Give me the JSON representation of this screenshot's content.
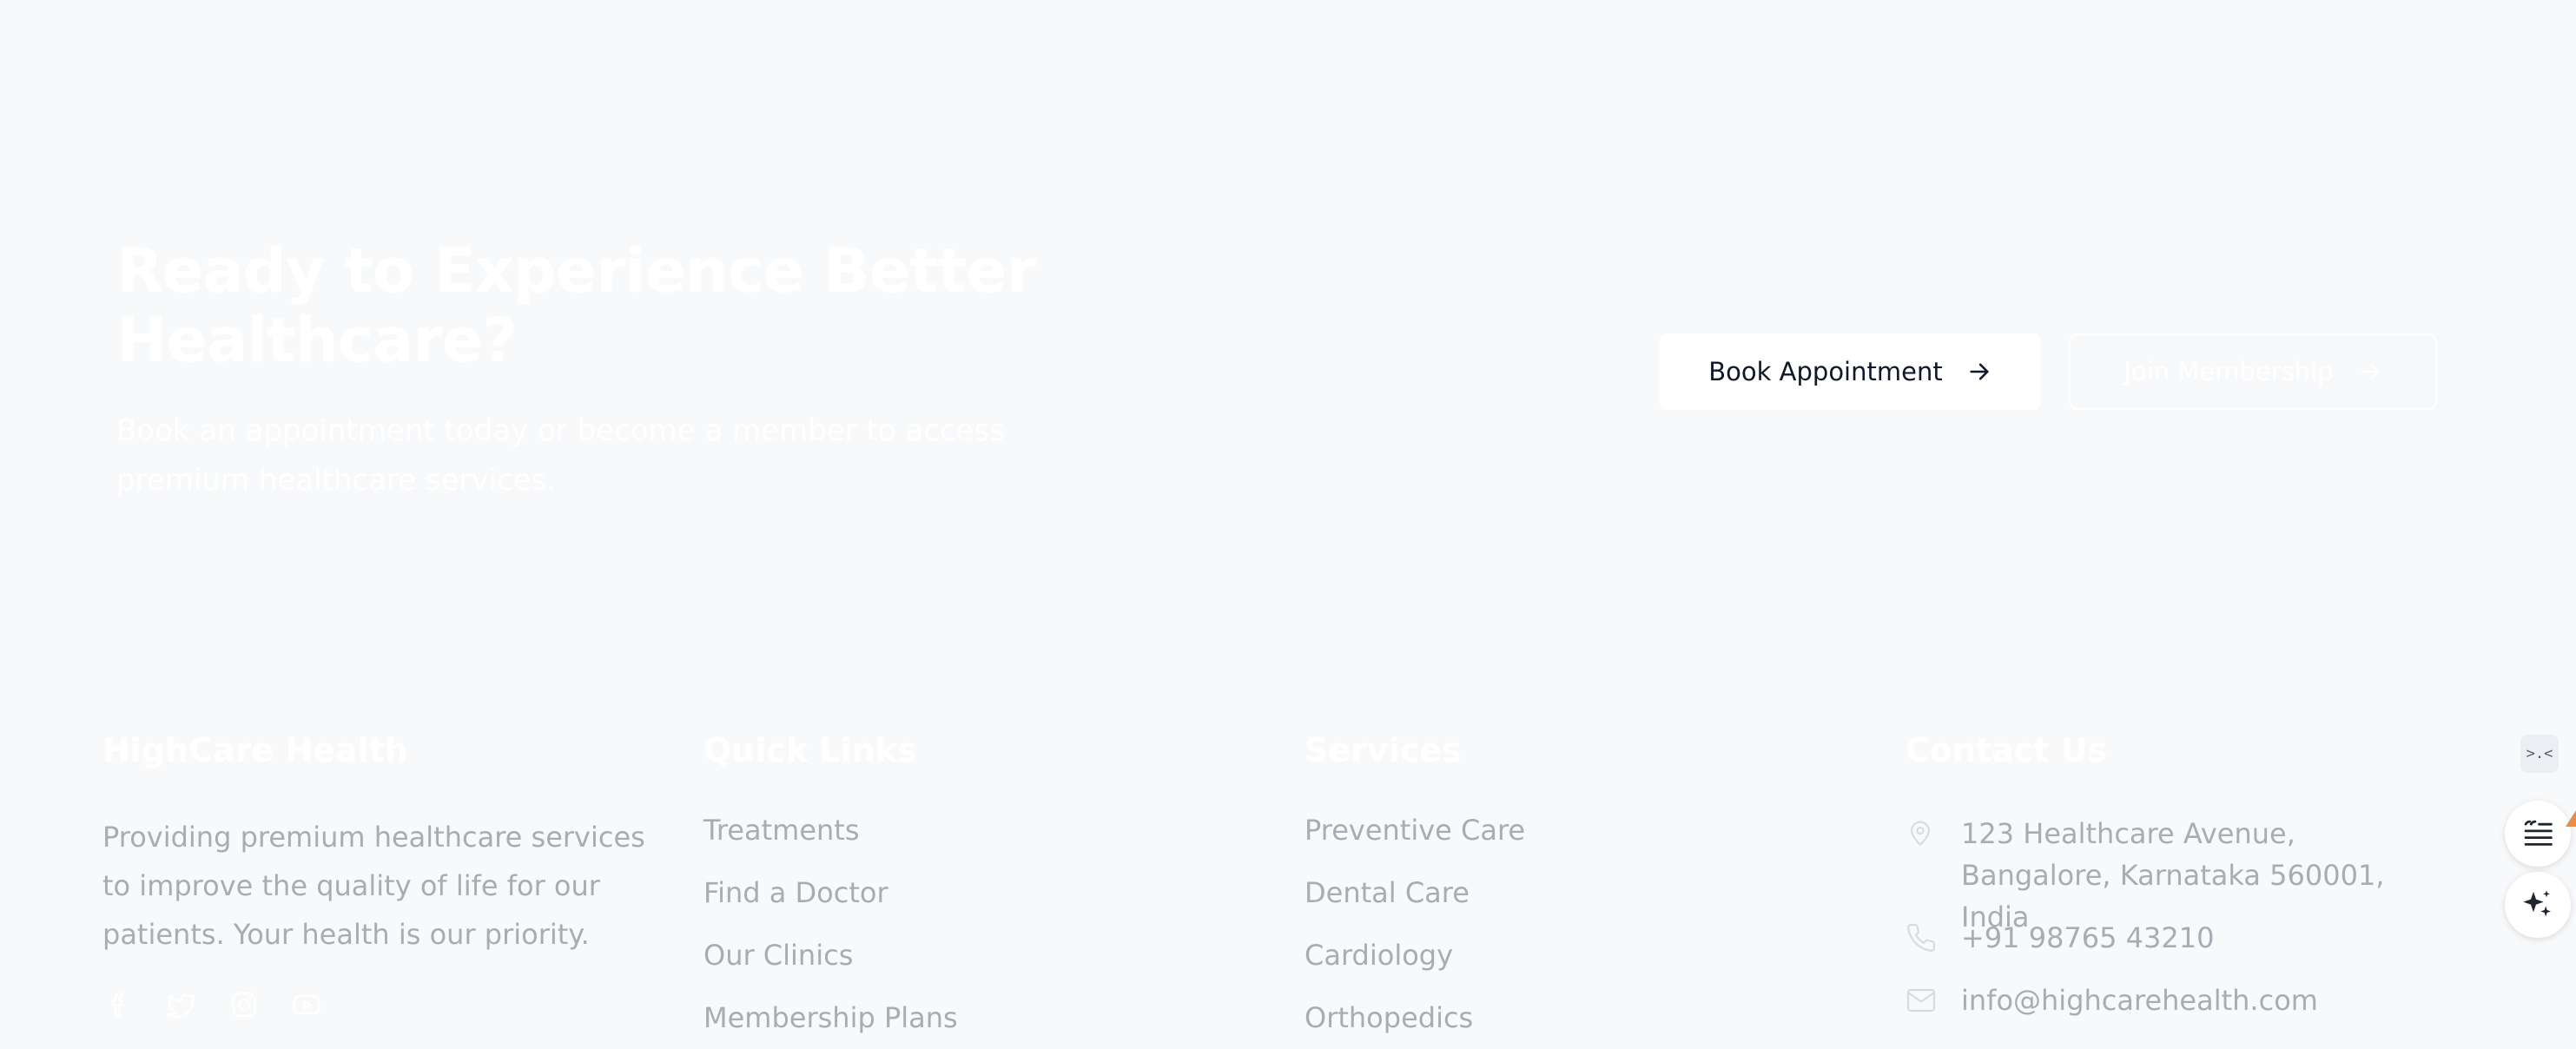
{
  "cta": {
    "title": "Ready to Experience Better Healthcare?",
    "subtitle": "Book an appointment today or become a member to access premium healthcare services.",
    "book_button": "Book Appointment",
    "join_button": "Join Membership"
  },
  "footer": {
    "brand": {
      "name": "HighCare Health",
      "description": "Providing premium healthcare services to improve the quality of life for our patients. Your health is our priority.",
      "socials": [
        "facebook-icon",
        "twitter-icon",
        "instagram-icon",
        "youtube-icon"
      ]
    },
    "quick_links": {
      "title": "Quick Links",
      "items": [
        "Treatments",
        "Find a Doctor",
        "Our Clinics",
        "Membership Plans"
      ]
    },
    "services": {
      "title": "Services",
      "items": [
        "Preventive Care",
        "Dental Care",
        "Cardiology",
        "Orthopedics"
      ]
    },
    "contact": {
      "title": "Contact Us",
      "address": "123 Healthcare Avenue, Bangalore, Karnataka 560001, India",
      "phone": "+91 98765 43210",
      "email": "info@highcarehealth.com"
    }
  },
  "float_tools": {
    "top_glyph": ">.<",
    "icons": [
      "code-icon",
      "notes-icon",
      "sparkle-icon"
    ]
  },
  "colors": {
    "background": "#f8f9fb",
    "text_muted": "#a9acb3",
    "text_dark": "#0f172a",
    "accent_orange": "#f08a3c"
  }
}
